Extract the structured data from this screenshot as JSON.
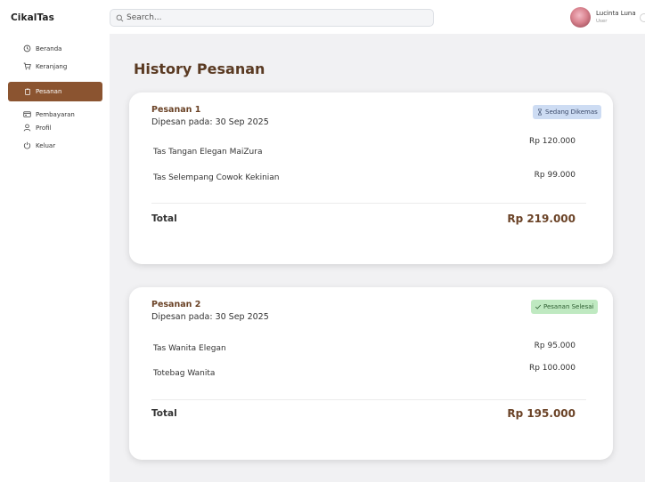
{
  "app": {
    "brand": "CikalTas"
  },
  "search": {
    "placeholder": "Search..."
  },
  "user": {
    "name": "Lucinta Luna",
    "role": "User"
  },
  "sidebar": {
    "items": [
      {
        "label": "Beranda",
        "icon": "clock-icon"
      },
      {
        "label": "Keranjang",
        "icon": "cart-icon"
      },
      {
        "label": "Pesanan",
        "icon": "clipboard-icon",
        "active": true
      },
      {
        "label": "Pembayaran",
        "icon": "payment-icon"
      },
      {
        "label": "Profil",
        "icon": "user-icon"
      },
      {
        "label": "Keluar",
        "icon": "power-icon"
      }
    ]
  },
  "main": {
    "title": "History Pesanan",
    "orders": [
      {
        "title": "Pesanan 1",
        "date": "Dipesan pada: 30 Sep 2025",
        "status": "Sedang Dikemas",
        "items": [
          {
            "name": "Tas Tangan Elegan MaiZura",
            "price": "Rp 120.000"
          },
          {
            "name": "Tas Selempang Cowok Kekinian",
            "price": "Rp 99.000"
          }
        ],
        "total_label": "Total",
        "total": "Rp 219.000"
      },
      {
        "title": "Pesanan 2",
        "date": "Dipesan pada: 30 Sep 2025",
        "status": "Pesanan Selesai",
        "items": [
          {
            "name": "Tas Wanita Elegan",
            "price": "Rp 95.000"
          },
          {
            "name": "Totebag Wanita",
            "price": "Rp 100.000"
          }
        ],
        "total_label": "Total",
        "total": "Rp 195.000"
      }
    ]
  },
  "colors": {
    "accent": "#8b5430",
    "title": "#5a3a22",
    "badge_processing": "#cddcf3",
    "badge_done": "#bfe9c1",
    "background": "#f1f1f3"
  }
}
